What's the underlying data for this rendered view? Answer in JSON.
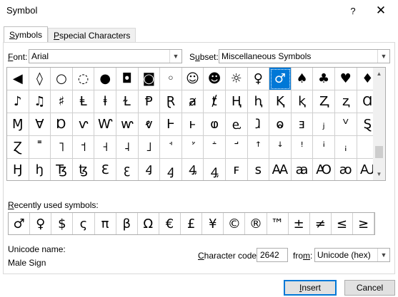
{
  "window": {
    "title": "Symbol",
    "help": "?",
    "close": "✕"
  },
  "tabs": [
    {
      "label": "Symbols",
      "key": "S",
      "rest": "ymbols",
      "active": true
    },
    {
      "label": "Special Characters",
      "key": "P",
      "rest": "special Characters",
      "active": false
    }
  ],
  "font": {
    "label_key": "F",
    "label_rest": "ont:",
    "value": "Arial"
  },
  "subset": {
    "label_key": "u",
    "label_pre": "S",
    "label_rest": "bset:",
    "value": "Miscellaneous Symbols"
  },
  "grid": {
    "rows": [
      [
        "◀",
        "◊",
        "○",
        "◌",
        "●",
        "◘",
        "◙",
        "◦",
        "☺",
        "☻",
        "☼",
        "♀",
        "♂",
        "♠",
        "♣",
        "♥",
        "♦"
      ],
      [
        "♪",
        "♫",
        "♯",
        "Ⱡ",
        "ⱡ",
        "Ɫ",
        "Ᵽ",
        "Ɽ",
        "ⱥ",
        "ⱦ",
        "Ⱨ",
        "ⱨ",
        "Ⱪ",
        "ⱪ",
        "Ⱬ",
        "ⱬ",
        "Ɑ"
      ],
      [
        "Ɱ",
        "Ɐ",
        "Ɒ",
        "ⱱ",
        "Ⱳ",
        "ⱳ",
        "ⱴ",
        "Ⱶ",
        "ⱶ",
        "ⱷ",
        "ⱸ",
        "ⱹ",
        "ⱺ",
        "ⱻ",
        "ⱼ",
        "ⱽ",
        "Ȿ"
      ],
      [
        "Ɀ",
        "˭",
        "˥",
        "˦",
        "˧",
        "˨",
        "˩",
        "ꜗ",
        "ꜘ",
        "ꜙ",
        "ꜚ",
        "ꜛ",
        "ꜜ",
        "ꜝ",
        "ꜞ",
        "ꜟ",
        ""
      ],
      [
        "Ꜧ",
        "ꜧ",
        "Ꜩ",
        "ꜩ",
        "Ꜫ",
        "ꜫ",
        "Ꜭ",
        "ꜭ",
        "Ꜯ",
        "ꜯ",
        "ꜰ",
        "ꜱ",
        "Ꜳ",
        "ꜳ",
        "Ꜵ",
        "ꜵ",
        "Ꜷ"
      ]
    ],
    "selected": "♂"
  },
  "recent": {
    "label_key": "R",
    "label_rest": "ecently used symbols:",
    "symbols": [
      "♂",
      "♀",
      "$",
      "ς",
      "π",
      "β",
      "Ω",
      "€",
      "£",
      "¥",
      "©",
      "®",
      "™",
      "±",
      "≠",
      "≤",
      "≥"
    ]
  },
  "unicode_name": {
    "label": "Unicode name:",
    "value": "Male Sign"
  },
  "char_code": {
    "label_key": "C",
    "label_rest": "haracter code:",
    "value": "2642"
  },
  "from": {
    "label_key": "m",
    "label_pre": "fro",
    "label_rest": ":",
    "value": "Unicode (hex)"
  },
  "buttons": {
    "insert": "Insert",
    "insert_key": "I",
    "insert_rest": "nsert",
    "cancel": "Cancel"
  }
}
